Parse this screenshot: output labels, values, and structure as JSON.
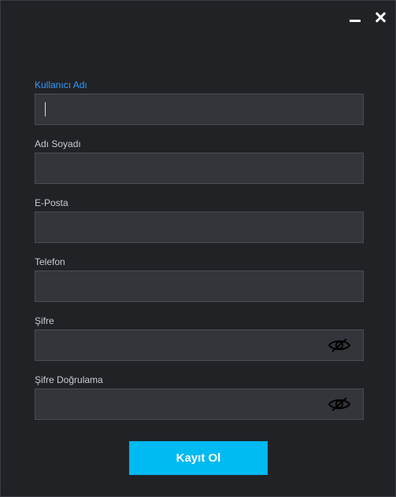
{
  "window": {
    "controls": {
      "minimize_icon": "minimize-icon",
      "close_icon": "close-icon"
    }
  },
  "form": {
    "fields": [
      {
        "label": "Kullanıcı Adı",
        "value": "",
        "active": true
      },
      {
        "label": "Adı Soyadı",
        "value": ""
      },
      {
        "label": "E-Posta",
        "value": ""
      },
      {
        "label": "Telefon",
        "value": ""
      },
      {
        "label": "Şifre",
        "value": "",
        "toggle_icon": "eye-slash-icon"
      },
      {
        "label": "Şifre Doğrulama",
        "value": "",
        "toggle_icon": "eye-slash-icon"
      }
    ],
    "submit_label": "Kayıt Ol"
  },
  "colors": {
    "background": "#212226",
    "input_background": "#33353b",
    "active_label": "#2f9bff",
    "label": "#c9ccd2",
    "accent": "#00baf2"
  }
}
